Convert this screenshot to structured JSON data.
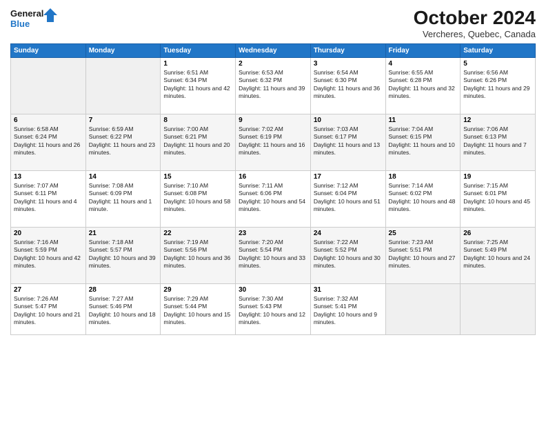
{
  "logo": {
    "line1": "General",
    "line2": "Blue"
  },
  "title": "October 2024",
  "location": "Vercheres, Quebec, Canada",
  "weekdays": [
    "Sunday",
    "Monday",
    "Tuesday",
    "Wednesday",
    "Thursday",
    "Friday",
    "Saturday"
  ],
  "weeks": [
    [
      {
        "day": "",
        "sunrise": "",
        "sunset": "",
        "daylight": ""
      },
      {
        "day": "",
        "sunrise": "",
        "sunset": "",
        "daylight": ""
      },
      {
        "day": "1",
        "sunrise": "Sunrise: 6:51 AM",
        "sunset": "Sunset: 6:34 PM",
        "daylight": "Daylight: 11 hours and 42 minutes."
      },
      {
        "day": "2",
        "sunrise": "Sunrise: 6:53 AM",
        "sunset": "Sunset: 6:32 PM",
        "daylight": "Daylight: 11 hours and 39 minutes."
      },
      {
        "day": "3",
        "sunrise": "Sunrise: 6:54 AM",
        "sunset": "Sunset: 6:30 PM",
        "daylight": "Daylight: 11 hours and 36 minutes."
      },
      {
        "day": "4",
        "sunrise": "Sunrise: 6:55 AM",
        "sunset": "Sunset: 6:28 PM",
        "daylight": "Daylight: 11 hours and 32 minutes."
      },
      {
        "day": "5",
        "sunrise": "Sunrise: 6:56 AM",
        "sunset": "Sunset: 6:26 PM",
        "daylight": "Daylight: 11 hours and 29 minutes."
      }
    ],
    [
      {
        "day": "6",
        "sunrise": "Sunrise: 6:58 AM",
        "sunset": "Sunset: 6:24 PM",
        "daylight": "Daylight: 11 hours and 26 minutes."
      },
      {
        "day": "7",
        "sunrise": "Sunrise: 6:59 AM",
        "sunset": "Sunset: 6:22 PM",
        "daylight": "Daylight: 11 hours and 23 minutes."
      },
      {
        "day": "8",
        "sunrise": "Sunrise: 7:00 AM",
        "sunset": "Sunset: 6:21 PM",
        "daylight": "Daylight: 11 hours and 20 minutes."
      },
      {
        "day": "9",
        "sunrise": "Sunrise: 7:02 AM",
        "sunset": "Sunset: 6:19 PM",
        "daylight": "Daylight: 11 hours and 16 minutes."
      },
      {
        "day": "10",
        "sunrise": "Sunrise: 7:03 AM",
        "sunset": "Sunset: 6:17 PM",
        "daylight": "Daylight: 11 hours and 13 minutes."
      },
      {
        "day": "11",
        "sunrise": "Sunrise: 7:04 AM",
        "sunset": "Sunset: 6:15 PM",
        "daylight": "Daylight: 11 hours and 10 minutes."
      },
      {
        "day": "12",
        "sunrise": "Sunrise: 7:06 AM",
        "sunset": "Sunset: 6:13 PM",
        "daylight": "Daylight: 11 hours and 7 minutes."
      }
    ],
    [
      {
        "day": "13",
        "sunrise": "Sunrise: 7:07 AM",
        "sunset": "Sunset: 6:11 PM",
        "daylight": "Daylight: 11 hours and 4 minutes."
      },
      {
        "day": "14",
        "sunrise": "Sunrise: 7:08 AM",
        "sunset": "Sunset: 6:09 PM",
        "daylight": "Daylight: 11 hours and 1 minute."
      },
      {
        "day": "15",
        "sunrise": "Sunrise: 7:10 AM",
        "sunset": "Sunset: 6:08 PM",
        "daylight": "Daylight: 10 hours and 58 minutes."
      },
      {
        "day": "16",
        "sunrise": "Sunrise: 7:11 AM",
        "sunset": "Sunset: 6:06 PM",
        "daylight": "Daylight: 10 hours and 54 minutes."
      },
      {
        "day": "17",
        "sunrise": "Sunrise: 7:12 AM",
        "sunset": "Sunset: 6:04 PM",
        "daylight": "Daylight: 10 hours and 51 minutes."
      },
      {
        "day": "18",
        "sunrise": "Sunrise: 7:14 AM",
        "sunset": "Sunset: 6:02 PM",
        "daylight": "Daylight: 10 hours and 48 minutes."
      },
      {
        "day": "19",
        "sunrise": "Sunrise: 7:15 AM",
        "sunset": "Sunset: 6:01 PM",
        "daylight": "Daylight: 10 hours and 45 minutes."
      }
    ],
    [
      {
        "day": "20",
        "sunrise": "Sunrise: 7:16 AM",
        "sunset": "Sunset: 5:59 PM",
        "daylight": "Daylight: 10 hours and 42 minutes."
      },
      {
        "day": "21",
        "sunrise": "Sunrise: 7:18 AM",
        "sunset": "Sunset: 5:57 PM",
        "daylight": "Daylight: 10 hours and 39 minutes."
      },
      {
        "day": "22",
        "sunrise": "Sunrise: 7:19 AM",
        "sunset": "Sunset: 5:56 PM",
        "daylight": "Daylight: 10 hours and 36 minutes."
      },
      {
        "day": "23",
        "sunrise": "Sunrise: 7:20 AM",
        "sunset": "Sunset: 5:54 PM",
        "daylight": "Daylight: 10 hours and 33 minutes."
      },
      {
        "day": "24",
        "sunrise": "Sunrise: 7:22 AM",
        "sunset": "Sunset: 5:52 PM",
        "daylight": "Daylight: 10 hours and 30 minutes."
      },
      {
        "day": "25",
        "sunrise": "Sunrise: 7:23 AM",
        "sunset": "Sunset: 5:51 PM",
        "daylight": "Daylight: 10 hours and 27 minutes."
      },
      {
        "day": "26",
        "sunrise": "Sunrise: 7:25 AM",
        "sunset": "Sunset: 5:49 PM",
        "daylight": "Daylight: 10 hours and 24 minutes."
      }
    ],
    [
      {
        "day": "27",
        "sunrise": "Sunrise: 7:26 AM",
        "sunset": "Sunset: 5:47 PM",
        "daylight": "Daylight: 10 hours and 21 minutes."
      },
      {
        "day": "28",
        "sunrise": "Sunrise: 7:27 AM",
        "sunset": "Sunset: 5:46 PM",
        "daylight": "Daylight: 10 hours and 18 minutes."
      },
      {
        "day": "29",
        "sunrise": "Sunrise: 7:29 AM",
        "sunset": "Sunset: 5:44 PM",
        "daylight": "Daylight: 10 hours and 15 minutes."
      },
      {
        "day": "30",
        "sunrise": "Sunrise: 7:30 AM",
        "sunset": "Sunset: 5:43 PM",
        "daylight": "Daylight: 10 hours and 12 minutes."
      },
      {
        "day": "31",
        "sunrise": "Sunrise: 7:32 AM",
        "sunset": "Sunset: 5:41 PM",
        "daylight": "Daylight: 10 hours and 9 minutes."
      },
      {
        "day": "",
        "sunrise": "",
        "sunset": "",
        "daylight": ""
      },
      {
        "day": "",
        "sunrise": "",
        "sunset": "",
        "daylight": ""
      }
    ]
  ]
}
